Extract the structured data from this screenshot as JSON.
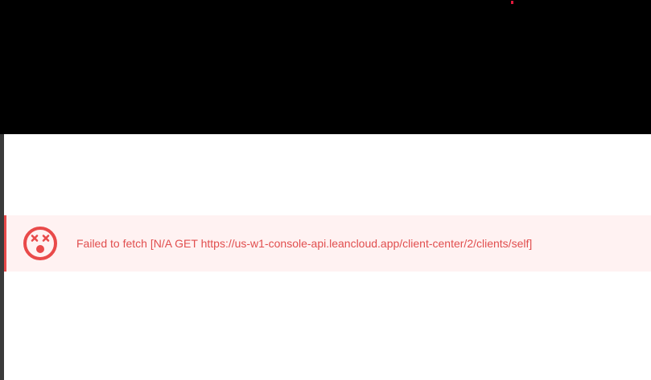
{
  "alert": {
    "icon": "dizzy-face-icon",
    "message": "Failed to fetch [N/A GET https://us-w1-console-api.leancloud.app/client-center/2/clients/self]",
    "color": "#e94a4a",
    "background": "#fff2f2"
  },
  "header": {
    "background": "#000000",
    "indicator_color": "#e0193c"
  }
}
